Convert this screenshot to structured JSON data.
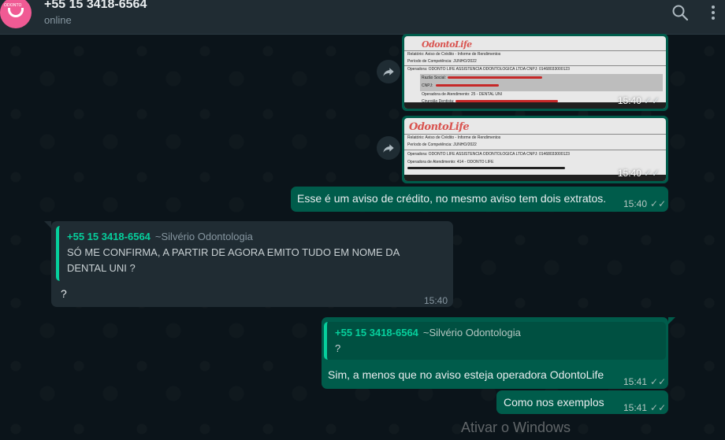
{
  "header": {
    "contact_name": "+55 15 3418-6564",
    "status": "online",
    "icons": [
      "avatar",
      "search-icon",
      "menu-icon"
    ]
  },
  "messages": [
    {
      "type": "image",
      "direction": "out",
      "time": "15:40",
      "doc": {
        "logo": "OdontoLife",
        "lines": [
          "Relatório: Aviso de Crédito - Informe de Rendimentos",
          "Período de Competência: JUNHO/2022",
          "Operadora: ODONTO LIFE ASSISTENCIA ODONTOLOGICA LTDA    CNPJ: 01468033000123",
          "Razão Social:",
          "CNPJ:",
          "Operadora de Atendimento:     25 - DENTAL UNI",
          "Cirurgião Dentista:"
        ]
      }
    },
    {
      "type": "image",
      "direction": "out",
      "time": "15:40",
      "doc": {
        "logo": "OdontoLife",
        "lines": [
          "Relatório:  Aviso de Crédito - Informe de Rendimentos",
          "Período de Competência: JUNHO/2022",
          "Operadora: ODONTO LIFE ASSISTENCIA ODONTOLOGICA LTDA    CNPJ: 01468033000123",
          "Operadora de Atendimento:          414 - ODONTO LIFE"
        ]
      }
    },
    {
      "type": "text",
      "direction": "out",
      "text": "Esse é um aviso de crédito, no mesmo aviso tem dois extratos.",
      "time": "15:40"
    },
    {
      "type": "reply",
      "direction": "in",
      "quote_number": "+55 15 3418-6564",
      "quote_name": "~Silvério Odontologia",
      "quote_text": "SÓ ME CONFIRMA, A PARTIR DE AGORA EMITO TUDO EM NOME DA DENTAL UNI ?",
      "text": "?",
      "time": "15:40"
    },
    {
      "type": "reply",
      "direction": "out",
      "quote_number": "+55 15 3418-6564",
      "quote_name": "~Silvério Odontologia",
      "quote_text": "?",
      "text": "Sim, a menos que no aviso esteja operadora OdontoLife",
      "time": "15:41"
    },
    {
      "type": "text",
      "direction": "out",
      "text": "Como nos exemplos",
      "time": "15:41"
    }
  ],
  "watermark": "Ativar o Windows",
  "colors": {
    "background": "#0b141a",
    "header": "#202c33",
    "outgoing": "#005c4b",
    "incoming": "#202c33",
    "quote_accent": "#06cf9c"
  }
}
